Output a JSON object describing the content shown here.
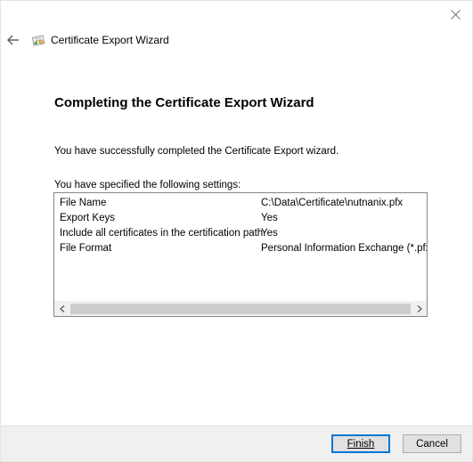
{
  "window": {
    "title": "Certificate Export Wizard"
  },
  "page": {
    "heading": "Completing the Certificate Export Wizard",
    "success_text": "You have successfully completed the Certificate Export wizard.",
    "settings_label": "You have specified the following settings:"
  },
  "settings": [
    {
      "key": "File Name",
      "value": "C:\\Data\\Certificate\\nutnanix.pfx"
    },
    {
      "key": "Export Keys",
      "value": "Yes"
    },
    {
      "key": "Include all certificates in the certification path",
      "value": "Yes"
    },
    {
      "key": "File Format",
      "value": "Personal Information Exchange (*.pfx)"
    }
  ],
  "buttons": {
    "finish": "Finish",
    "cancel": "Cancel"
  },
  "icons": {
    "close": "close-icon",
    "back": "back-arrow-icon",
    "wizard": "certificate-icon",
    "scroll_left": "chevron-left-icon",
    "scroll_right": "chevron-right-icon"
  },
  "colors": {
    "accent": "#0078d7",
    "footer_bg": "#f0f0f0",
    "button_bg": "#e1e1e1"
  }
}
